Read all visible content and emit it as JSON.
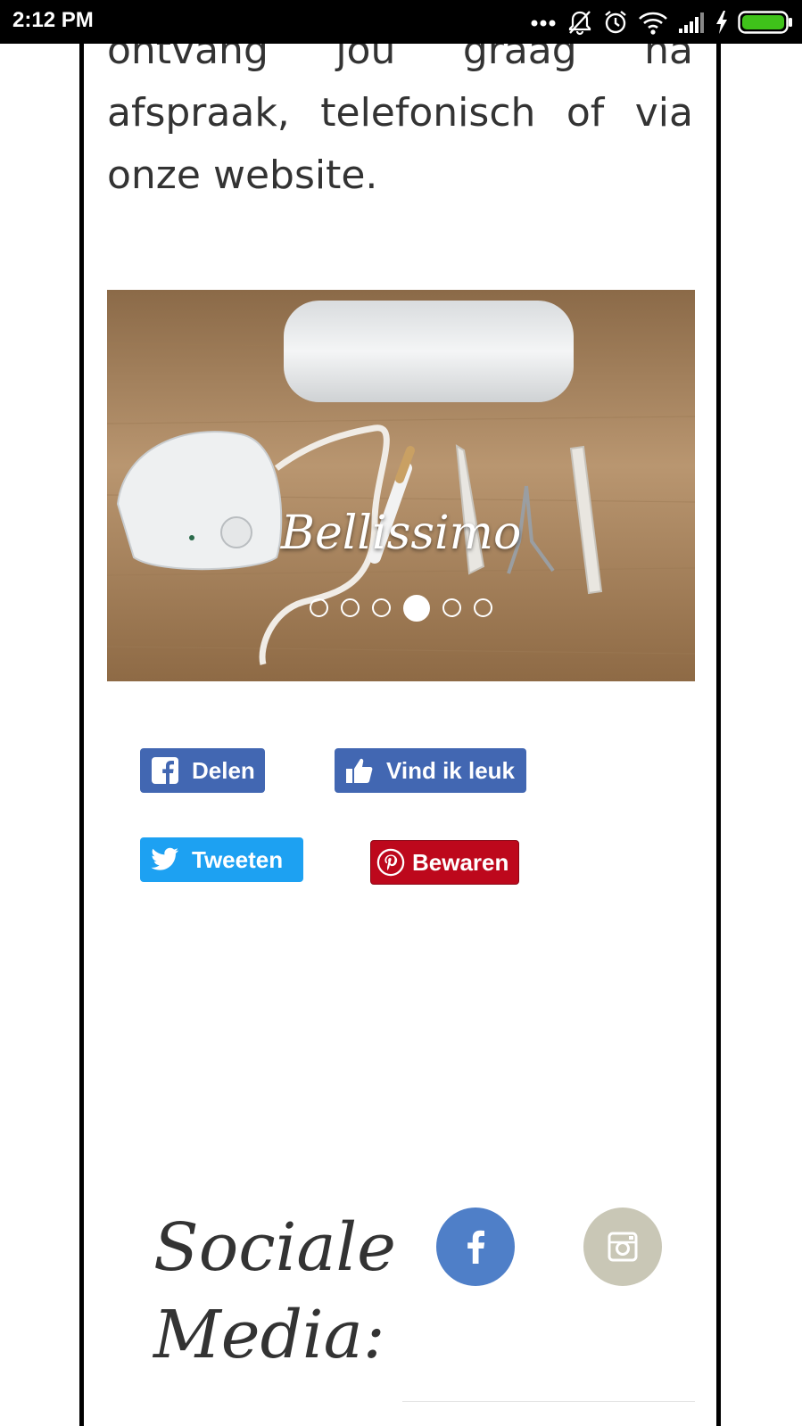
{
  "status_bar": {
    "time": "2:12 PM",
    "icons": [
      "more-dots-icon",
      "notifications-muted-icon",
      "alarm-icon",
      "wifi-icon",
      "signal-icon",
      "charging-icon",
      "battery-icon"
    ],
    "battery_color": "#3fc21a"
  },
  "intro": {
    "line1": "ontvang jou graag na",
    "line2": "afspraak, telefonisch of via",
    "line3": "onze website."
  },
  "slider": {
    "caption": "Bellissimo",
    "slide_count": 6,
    "active_slide": 4
  },
  "share": {
    "facebook_share_label": "Delen",
    "facebook_like_label": "Vind ik leuk",
    "twitter_label": "Tweeten",
    "pinterest_label": "Bewaren",
    "colors": {
      "facebook": "#4267b2",
      "twitter": "#1da1f2",
      "pinterest": "#bd081c"
    }
  },
  "social": {
    "heading_line1": "Sociale",
    "heading_line2": "Media:",
    "facebook_icon": "facebook-icon",
    "instagram_icon": "instagram-icon",
    "facebook_color": "#4f7fc8",
    "instagram_color": "#c9c7b6"
  }
}
